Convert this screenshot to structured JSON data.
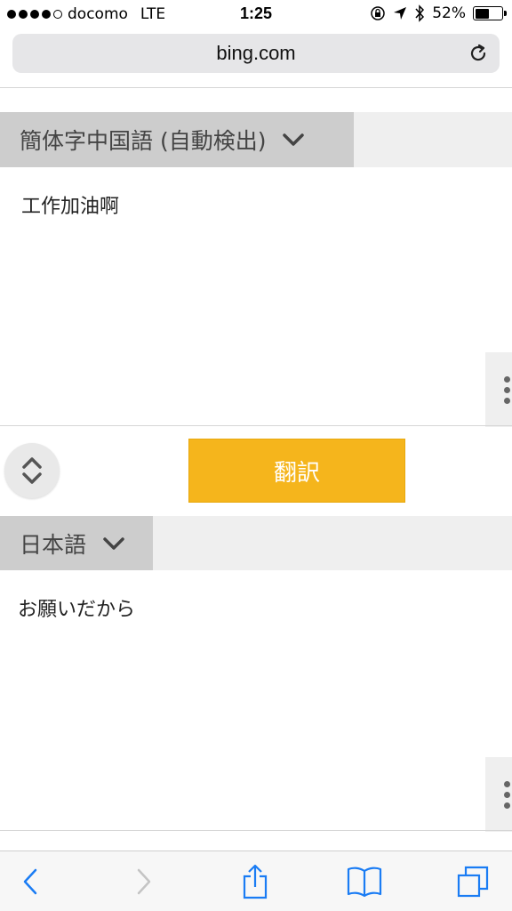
{
  "status_bar": {
    "carrier": "docomo",
    "network": "LTE",
    "time": "1:25",
    "battery": "52%",
    "battery_level": 0.52
  },
  "browser": {
    "url": "bing.com"
  },
  "translator": {
    "source_language": "簡体字中国語 (自動検出)",
    "source_text": "工作加油啊",
    "translate_label": "翻訳",
    "target_language": "日本語",
    "target_text": "お願いだから"
  },
  "colors": {
    "accent": "#f5b51c",
    "ios_blue": "#1a7cf4",
    "disabled": "#c4c4c4"
  }
}
